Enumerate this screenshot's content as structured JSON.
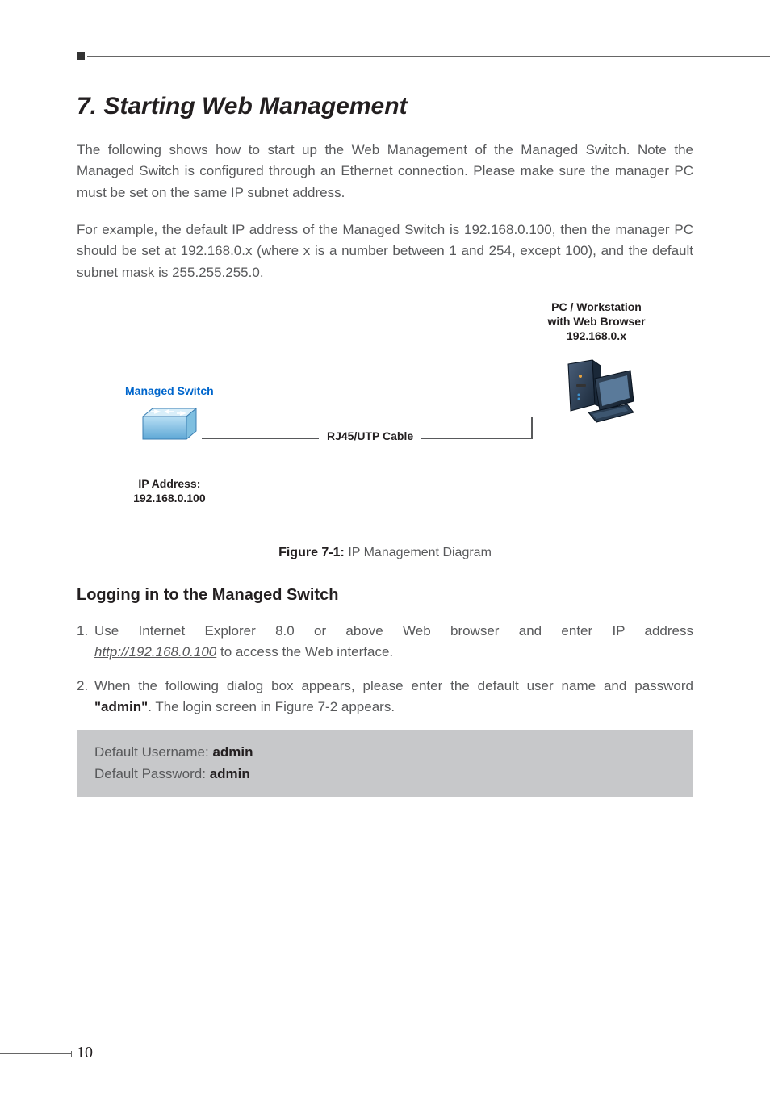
{
  "section": {
    "title": "7. Starting Web Management",
    "paragraph1": "The following shows how to start up the Web Management of the Managed Switch. Note the Managed Switch is configured through an Ethernet connection. Please make sure the manager PC must be set on the same IP subnet address.",
    "paragraph2": "For example, the default IP address of the Managed Switch is 192.168.0.100, then the manager PC should be set at 192.168.0.x (where x is a number between 1 and 254, except 100), and the default subnet mask is 255.255.255.0."
  },
  "diagram": {
    "switch_label": "Managed Switch",
    "switch_ip_label": "IP Address:",
    "switch_ip_value": "192.168.0.100",
    "cable_label": "RJ45/UTP Cable",
    "pc_line1": "PC / Workstation",
    "pc_line2": "with Web Browser",
    "pc_line3": "192.168.0.x",
    "figure_label": "Figure 7-1:",
    "figure_text": "IP Management Diagram"
  },
  "subsection": {
    "title": "Logging in to the Managed Switch",
    "step1_pre": "Use Internet Explorer 8.0 or above Web browser and enter IP address ",
    "step1_url": "http://192.168.0.100",
    "step1_post": " to access the Web interface.",
    "step2_pre": "When the following dialog box appears, please enter the default user name and password ",
    "step2_bold": "\"admin\"",
    "step2_post": ". The login screen in Figure 7-2 appears."
  },
  "credentials": {
    "username_label": "Default Username: ",
    "username_value": "admin",
    "password_label": "Default Password: ",
    "password_value": "admin"
  },
  "page_number": "10"
}
